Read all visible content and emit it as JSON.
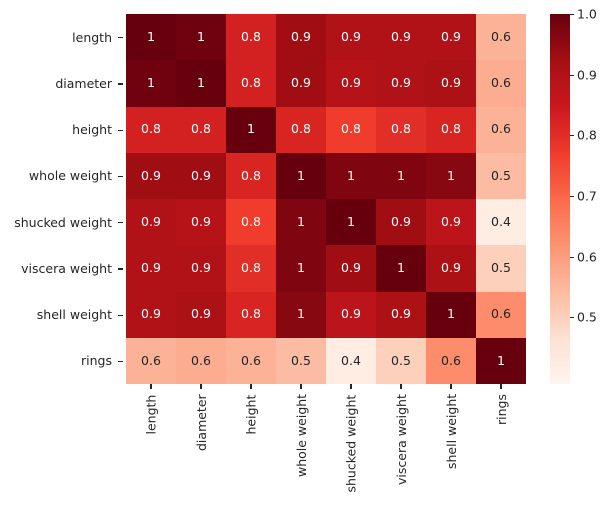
{
  "chart_data": {
    "type": "heatmap",
    "title": "",
    "xlabel": "",
    "ylabel": "",
    "grid": false,
    "legend_position": "right",
    "colormap": "Reds",
    "categories": [
      "length",
      "diameter",
      "height",
      "whole weight",
      "shucked weight",
      "viscera weight",
      "shell weight",
      "rings"
    ],
    "x_tick_labels": [
      "length",
      "diameter",
      "height",
      "whole weight",
      "shucked weight",
      "viscera weight",
      "shell weight",
      "rings"
    ],
    "y_tick_labels": [
      "length",
      "diameter",
      "height",
      "whole weight",
      "shucked weight",
      "viscera weight",
      "shell weight",
      "rings"
    ],
    "annotations": [
      [
        "1",
        "1",
        "0.8",
        "0.9",
        "0.9",
        "0.9",
        "0.9",
        "0.6"
      ],
      [
        "1",
        "1",
        "0.8",
        "0.9",
        "0.9",
        "0.9",
        "0.9",
        "0.6"
      ],
      [
        "0.8",
        "0.8",
        "1",
        "0.8",
        "0.8",
        "0.8",
        "0.8",
        "0.6"
      ],
      [
        "0.9",
        "0.9",
        "0.8",
        "1",
        "1",
        "1",
        "1",
        "0.5"
      ],
      [
        "0.9",
        "0.9",
        "0.8",
        "1",
        "1",
        "0.9",
        "0.9",
        "0.4"
      ],
      [
        "0.9",
        "0.9",
        "0.8",
        "1",
        "0.9",
        "1",
        "0.9",
        "0.5"
      ],
      [
        "0.9",
        "0.9",
        "0.8",
        "1",
        "0.9",
        "0.9",
        "1",
        "0.6"
      ],
      [
        "0.6",
        "0.6",
        "0.6",
        "0.5",
        "0.4",
        "0.5",
        "0.6",
        "1"
      ]
    ],
    "values": [
      [
        1.0,
        0.99,
        0.83,
        0.93,
        0.9,
        0.9,
        0.9,
        0.56
      ],
      [
        0.99,
        1.0,
        0.83,
        0.93,
        0.89,
        0.9,
        0.91,
        0.57
      ],
      [
        0.83,
        0.83,
        1.0,
        0.82,
        0.77,
        0.8,
        0.82,
        0.56
      ],
      [
        0.93,
        0.93,
        0.82,
        1.0,
        0.97,
        0.97,
        0.96,
        0.54
      ],
      [
        0.9,
        0.89,
        0.77,
        0.97,
        1.0,
        0.93,
        0.88,
        0.42
      ],
      [
        0.9,
        0.9,
        0.8,
        0.97,
        0.93,
        1.0,
        0.91,
        0.5
      ],
      [
        0.9,
        0.91,
        0.82,
        0.96,
        0.88,
        0.91,
        1.0,
        0.63
      ],
      [
        0.56,
        0.57,
        0.56,
        0.54,
        0.42,
        0.5,
        0.63,
        1.0
      ]
    ],
    "vmin": 0.39,
    "vmax": 1.0,
    "colorbar": {
      "ticks": [
        "1.0",
        "0.9",
        "0.8",
        "0.7",
        "0.6",
        "0.5"
      ],
      "tick_values": [
        1.0,
        0.9,
        0.8,
        0.7,
        0.6,
        0.5
      ],
      "range": [
        0.39,
        1.0
      ],
      "gradient_stops": [
        "#67000d",
        "#a50f15",
        "#cb181d",
        "#ef3b2c",
        "#fb6a4a",
        "#fc9272",
        "#fcbba1"
      ]
    },
    "text_colors": {
      "dark_cell_text": "#ffffff",
      "light_cell_text": "#262626"
    },
    "tick_color": "#262626"
  }
}
